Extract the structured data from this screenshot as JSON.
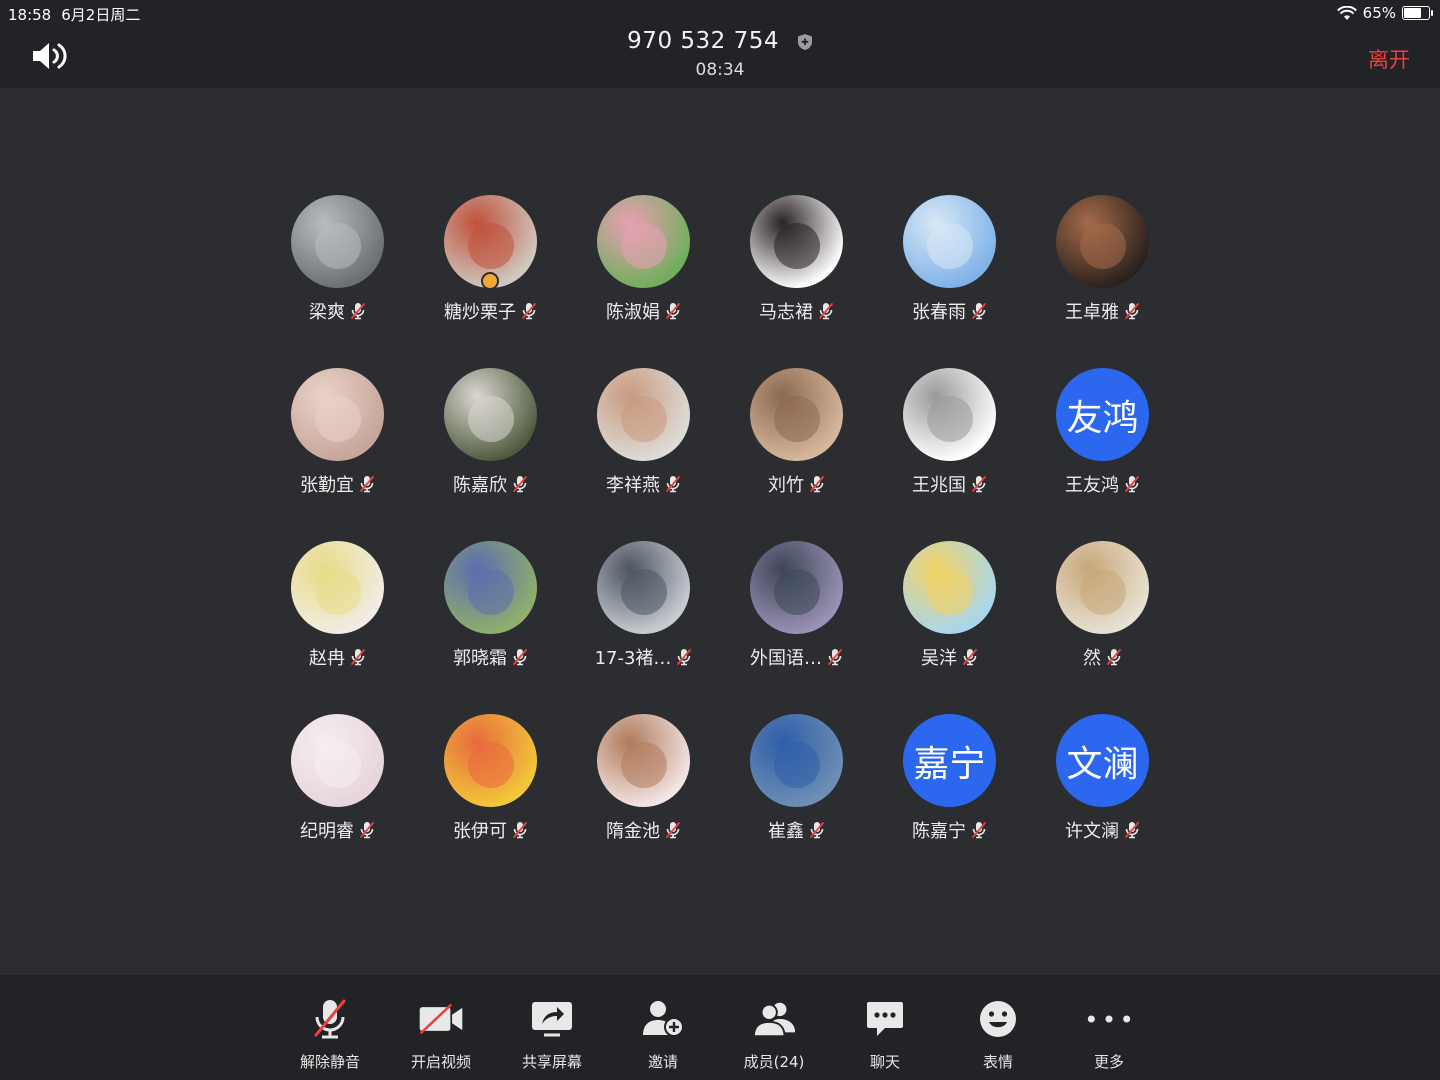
{
  "status_bar": {
    "time": "18:58",
    "date": "6月2日周二",
    "battery": "65%",
    "battery_level": 0.65
  },
  "header": {
    "meeting_id": "970 532 754",
    "duration": "08:34",
    "leave_label": "离开",
    "leave_color": "#e8423f"
  },
  "participants": [
    {
      "name": "梁爽",
      "avatar": "photo",
      "colors": [
        "#6b6f73",
        "#b9bcbf"
      ]
    },
    {
      "name": "糖炒栗子",
      "avatar": "photo",
      "colors": [
        "#cfc9c0",
        "#c0503b"
      ],
      "host": true
    },
    {
      "name": "陈淑娟",
      "avatar": "photo",
      "colors": [
        "#6fae5c",
        "#e9a0b4"
      ]
    },
    {
      "name": "马志裙",
      "avatar": "photo",
      "colors": [
        "#ffffff",
        "#2a2222"
      ]
    },
    {
      "name": "张春雨",
      "avatar": "photo",
      "colors": [
        "#7fb2e8",
        "#d8e8f6"
      ]
    },
    {
      "name": "王卓雅",
      "avatar": "photo",
      "colors": [
        "#2a211d",
        "#a56a4a"
      ]
    },
    {
      "name": "张勤宜",
      "avatar": "photo",
      "colors": [
        "#c7a59a",
        "#e9d2c8"
      ]
    },
    {
      "name": "陈嘉欣",
      "avatar": "photo",
      "colors": [
        "#4f5b3e",
        "#d9d6cf"
      ]
    },
    {
      "name": "李祥燕",
      "avatar": "photo",
      "colors": [
        "#dedcd8",
        "#c89a80"
      ]
    },
    {
      "name": "刘竹",
      "avatar": "photo",
      "colors": [
        "#d7b89c",
        "#8c6a50"
      ]
    },
    {
      "name": "王兆国",
      "avatar": "photo",
      "colors": [
        "#ffffff",
        "#9a9a9a"
      ]
    },
    {
      "name": "王友鸿",
      "avatar": "text",
      "initials": "友鸿"
    },
    {
      "name": "赵冉",
      "avatar": "photo",
      "colors": [
        "#f1ece6",
        "#e8dc86"
      ]
    },
    {
      "name": "郭晓霜",
      "avatar": "photo",
      "colors": [
        "#8fb06a",
        "#5c6dae"
      ]
    },
    {
      "name": "17-3褚…",
      "avatar": "photo",
      "colors": [
        "#c8ccd2",
        "#4d5560"
      ]
    },
    {
      "name": "外国语…",
      "avatar": "photo",
      "colors": [
        "#9b92b5",
        "#3d4758"
      ]
    },
    {
      "name": "吴洋",
      "avatar": "photo",
      "colors": [
        "#a8d6ee",
        "#f2d264"
      ]
    },
    {
      "name": "然",
      "avatar": "photo",
      "colors": [
        "#e7e2d3",
        "#c9a77a"
      ]
    },
    {
      "name": "纪明睿",
      "avatar": "photo",
      "colors": [
        "#e7d4dc",
        "#f5eef0"
      ]
    },
    {
      "name": "张伊可",
      "avatar": "photo",
      "colors": [
        "#f2c83a",
        "#e86a3e"
      ]
    },
    {
      "name": "隋金池",
      "avatar": "photo",
      "colors": [
        "#f4e6e6",
        "#b07b5c"
      ]
    },
    {
      "name": "崔鑫",
      "avatar": "photo",
      "colors": [
        "#6e8fb5",
        "#2f5ea8"
      ]
    },
    {
      "name": "陈嘉宁",
      "avatar": "text",
      "initials": "嘉宁"
    },
    {
      "name": "许文澜",
      "avatar": "text",
      "initials": "文澜"
    }
  ],
  "toolbar": {
    "unmute": "解除静音",
    "start_video": "开启视频",
    "share_screen": "共享屏幕",
    "invite": "邀请",
    "members": "成员(24)",
    "chat": "聊天",
    "reactions": "表情",
    "more": "更多"
  },
  "icons": {
    "speaker": "speaker-icon",
    "shield": "shield-icon",
    "mic_muted": "mic-muted-icon",
    "video_off": "video-off-icon",
    "share": "share-screen-icon",
    "invite": "add-user-icon",
    "members": "members-icon",
    "chat": "chat-icon",
    "reactions": "smile-icon",
    "more": "more-dots-icon"
  },
  "colors": {
    "background": "#2b2d31",
    "bar": "#222326",
    "avatar_text_bg": "#2c68ef",
    "muted_red": "#e8423f"
  }
}
